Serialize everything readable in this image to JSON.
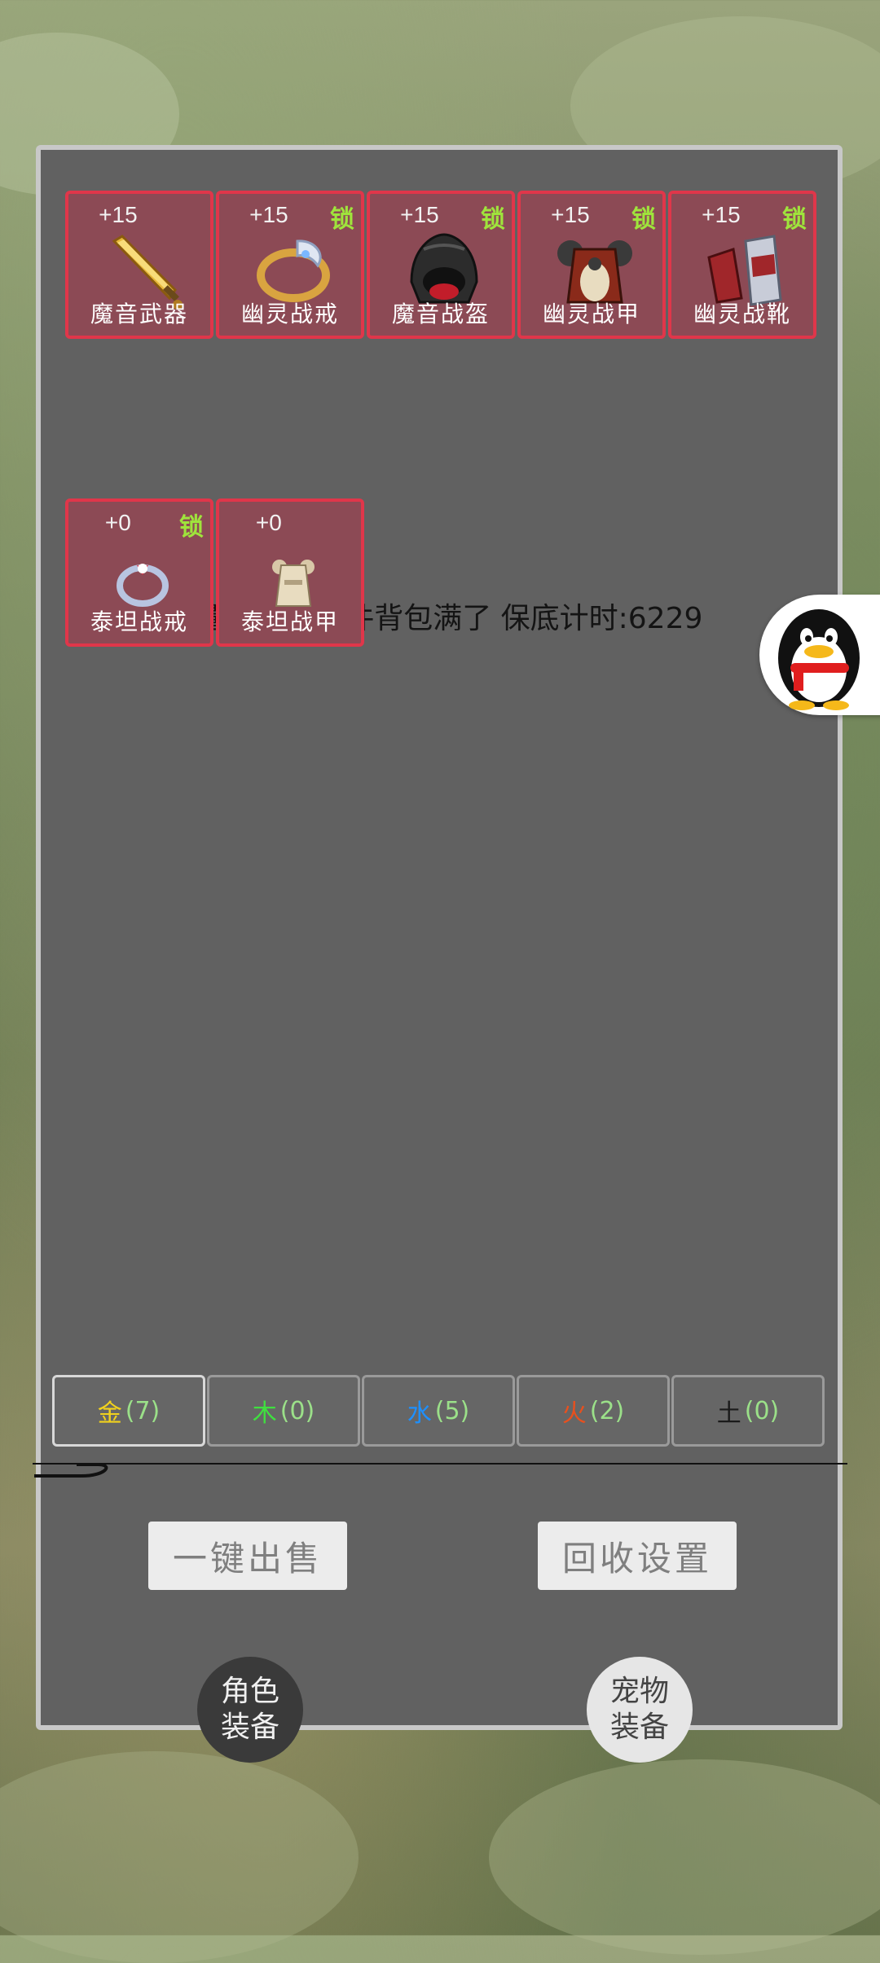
{
  "equipped": [
    {
      "level": "+15",
      "locked": false,
      "name": "魔音武器",
      "icon": "golden-sword-icon"
    },
    {
      "level": "+15",
      "lock_label": "锁",
      "name": "幽灵战戒",
      "icon": "ring-icon"
    },
    {
      "level": "+15",
      "lock_label": "锁",
      "name": "魔音战盔",
      "icon": "helmet-icon"
    },
    {
      "level": "+15",
      "lock_label": "锁",
      "name": "幽灵战甲",
      "icon": "armor-icon"
    },
    {
      "level": "+15",
      "lock_label": "锁",
      "name": "幽灵战靴",
      "icon": "boots-icon"
    }
  ],
  "info_text": "装备数量:12件,40件背包满了 保底计时:6229",
  "bag": [
    {
      "level": "+0",
      "lock_label": "锁",
      "name": "泰坦战戒",
      "icon": "ring-icon"
    },
    {
      "level": "+0",
      "name": "泰坦战甲",
      "icon": "armor-icon"
    }
  ],
  "element_tabs": [
    {
      "label": "金",
      "count": "(7)",
      "color": "#f2d21c"
    },
    {
      "label": "木",
      "count": "(0)",
      "color": "#3fe03f"
    },
    {
      "label": "水",
      "count": "(5)",
      "color": "#1e90ff"
    },
    {
      "label": "火",
      "count": "(2)",
      "color": "#e8501e"
    },
    {
      "label": "土",
      "count": "(0)",
      "color": "#1a1a1a"
    }
  ],
  "actions": {
    "sell_all": "一键出售",
    "recycle_settings": "回收设置"
  },
  "bottom_nav": {
    "character_line1": "角色",
    "character_line2": "装备",
    "pet_line1": "宠物",
    "pet_line2": "装备"
  },
  "colors": {
    "slot_border": "#e0364a",
    "lock": "#9fe43c"
  }
}
